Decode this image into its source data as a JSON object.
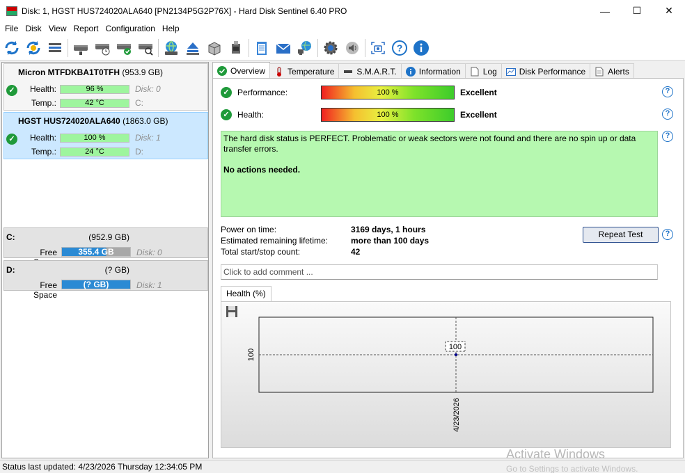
{
  "window": {
    "title": "Disk: 1, HGST HUS724020ALA640 [PN2134P5G2P76X]  -  Hard Disk Sentinel 6.40 PRO",
    "minimize": "—",
    "maximize": "☐",
    "close": "✕"
  },
  "menu": {
    "items": [
      "File",
      "Disk",
      "View",
      "Report",
      "Configuration",
      "Help"
    ]
  },
  "toolbar": {
    "icons": [
      "refresh-icon",
      "refresh-all-icon",
      "disk-list-icon",
      "disk-icon",
      "disk-schedule-icon",
      "disk-ok-icon",
      "disk-search-icon",
      "globe-disk-icon",
      "eject-icon",
      "server-icon",
      "usb-drive-icon",
      "notepad-icon",
      "mail-icon",
      "network-icon",
      "settings-icon",
      "sound-icon",
      "screenshot-icon",
      "help-icon",
      "info-icon"
    ]
  },
  "disks": [
    {
      "model": "Micron MTFDKBA1T0TFH",
      "size": "(953.9 GB)",
      "health_label": "Health:",
      "health": "96 %",
      "health_fraction": 0.96,
      "temp_label": "Temp.:",
      "temp": "42 °C",
      "disk_index": "Disk: 0",
      "drive": "C:"
    },
    {
      "model": "HGST HUS724020ALA640",
      "size": "(1863.0 GB)",
      "health_label": "Health:",
      "health": "100 %",
      "health_fraction": 1.0,
      "temp_label": "Temp.:",
      "temp": "24 °C",
      "disk_index": "Disk: 1",
      "drive": "D:"
    }
  ],
  "volumes": [
    {
      "letter": "C:",
      "size": "(952.9 GB)",
      "free_label": "Free Space",
      "free": "355.4 GB",
      "disk": "Disk: 0"
    },
    {
      "letter": "D:",
      "size": "(? GB)",
      "free_label": "Free Space",
      "free": "(? GB)",
      "disk": "Disk: 1"
    }
  ],
  "tabs": [
    "Overview",
    "Temperature",
    "S.M.A.R.T.",
    "Information",
    "Log",
    "Disk Performance",
    "Alerts"
  ],
  "overview": {
    "performance_label": "Performance:",
    "performance": "100 %",
    "performance_rating": "Excellent",
    "health_label": "Health:",
    "health": "100 %",
    "health_rating": "Excellent",
    "status_text": "The hard disk status is PERFECT. Problematic or weak sectors were not found and there are no spin up or data transfer errors.",
    "status_action": "No actions needed.",
    "power_on_label": "Power on time:",
    "power_on": "3169 days, 1 hours",
    "lifetime_label": "Estimated remaining lifetime:",
    "lifetime": "more than 100 days",
    "startstop_label": "Total start/stop count:",
    "startstop": "42",
    "repeat_test": "Repeat Test",
    "comment_placeholder": "Click to add comment ...",
    "help_glyph": "?"
  },
  "chart_data": {
    "type": "scatter",
    "tab_label": "Health (%)",
    "x": [
      "4/23/2026"
    ],
    "values": [
      100
    ],
    "data_label": "100",
    "ytick": "100",
    "xtick": "4/23/2026"
  },
  "statusbar": {
    "text": "Status last updated: 4/23/2026 Thursday 12:34:05 PM"
  },
  "watermark": {
    "line1": "Activate Windows",
    "line2": "Go to Settings to activate Windows."
  }
}
